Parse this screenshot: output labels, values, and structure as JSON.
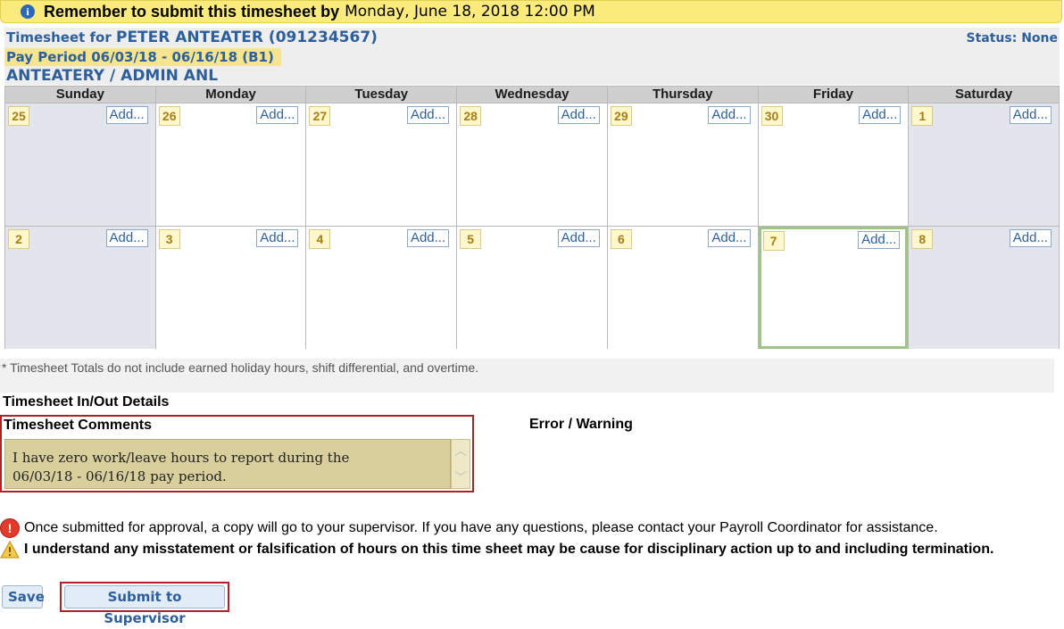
{
  "banner": {
    "icon": "info-icon",
    "message": "Remember to submit this timesheet by",
    "deadline": "Monday, June 18, 2018  12:00 PM"
  },
  "header": {
    "timesheet_label": "Timesheet for ",
    "employee": "PETER ANTEATER (091234567)",
    "status": "Status: None",
    "pay_period": "Pay Period 06/03/18 - 06/16/18 (B1)",
    "department": "ANTEATERY / ADMIN ANL"
  },
  "calendar": {
    "days": [
      "Sunday",
      "Monday",
      "Tuesday",
      "Wednesday",
      "Thursday",
      "Friday",
      "Saturday"
    ],
    "add_label": "Add...",
    "week1": [
      "25",
      "26",
      "27",
      "28",
      "29",
      "30",
      "1"
    ],
    "week2": [
      "2",
      "3",
      "4",
      "5",
      "6",
      "7",
      "8"
    ],
    "highlighted_day": "7"
  },
  "footnote": "* Timesheet Totals do not include earned holiday hours, shift differential, and overtime.",
  "inout_title": "Timesheet In/Out Details",
  "comments": {
    "title": "Timesheet Comments",
    "text": "I have zero work/leave hours to report during the\n06/03/18 - 06/16/18 pay period."
  },
  "error_label": "Error / Warning",
  "notices": {
    "submit_note": "Once submitted for approval, a copy will go to your supervisor. If you have any questions, please contact your Payroll Coordinator for assistance.",
    "warning": "I understand any misstatement or falsification of hours on this time sheet may be cause for disciplinary action up to and including termination."
  },
  "buttons": {
    "save": "Save",
    "submit": "Submit to Supervisor"
  },
  "colors": {
    "banner": "#fbeb7c",
    "accent_blue": "#2d5f9b",
    "highlight_border": "#9fc586",
    "alert_red": "#b21f24"
  }
}
